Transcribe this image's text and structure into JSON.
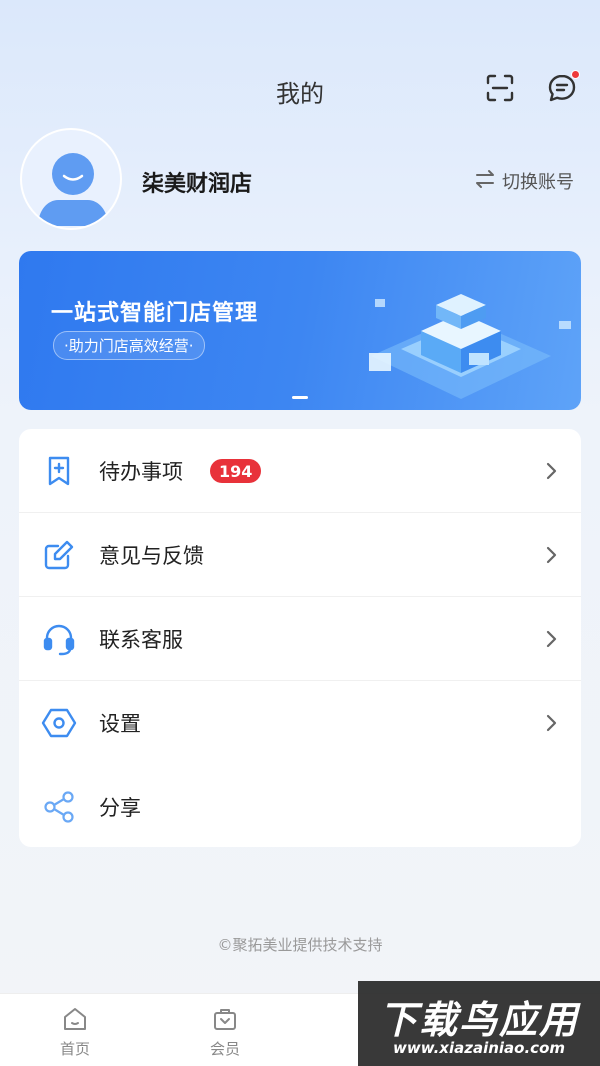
{
  "header": {
    "title": "我的"
  },
  "profile": {
    "shop_name": "柒美财润店",
    "switch_label": "切换账号"
  },
  "banner": {
    "title": "一站式智能门店管理",
    "subtitle": "·助力门店高效经营·"
  },
  "menu": {
    "items": [
      {
        "label": "待办事项",
        "icon": "bookmark-plus-icon",
        "badge": "194",
        "chevron": true
      },
      {
        "label": "意见与反馈",
        "icon": "edit-icon",
        "chevron": true
      },
      {
        "label": "联系客服",
        "icon": "headset-icon",
        "chevron": true
      },
      {
        "label": "设置",
        "icon": "settings-hexagon-icon",
        "chevron": true
      },
      {
        "label": "分享",
        "icon": "share-icon",
        "chevron": false
      }
    ]
  },
  "footer": {
    "note": "©聚拓美业提供技术支持"
  },
  "tabbar": {
    "tabs": [
      {
        "label": "首页",
        "icon": "home-icon"
      },
      {
        "label": "会员",
        "icon": "member-bag-icon"
      }
    ]
  },
  "watermark": {
    "text": "下载鸟应用",
    "url": "www.xiazainiao.com"
  },
  "colors": {
    "accent": "#2f79ef",
    "badge": "#e8323a",
    "icon": "#3d8cf0"
  }
}
